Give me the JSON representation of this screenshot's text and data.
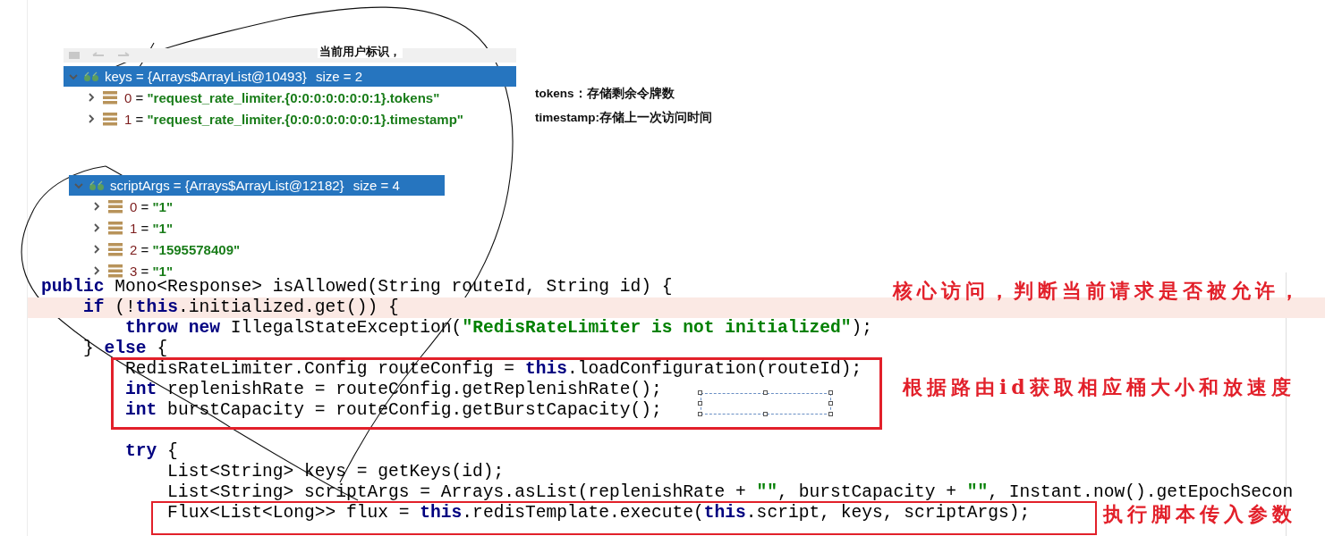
{
  "user_note": "当前用户标识，",
  "panels": [
    {
      "label": "keys = {Arrays$ArrayList@10493}",
      "size": "size = 2",
      "expanded": true,
      "selected": true,
      "items": [
        {
          "index": "0",
          "equals": "=",
          "value": "\"request_rate_limiter.{0:0:0:0:0:0:0:1}.tokens\"",
          "expanded": false
        },
        {
          "index": "1",
          "equals": "=",
          "value": "\"request_rate_limiter.{0:0:0:0:0:0:0:1}.timestamp\"",
          "expanded": false
        }
      ]
    },
    {
      "label": "scriptArgs = {Arrays$ArrayList@12182}",
      "size": "size = 4",
      "expanded": true,
      "selected": true,
      "items": [
        {
          "index": "0",
          "equals": "=",
          "value": "\"1\"",
          "expanded": false
        },
        {
          "index": "1",
          "equals": "=",
          "value": "\"1\"",
          "expanded": false
        },
        {
          "index": "2",
          "equals": "=",
          "value": "\"1595578409\"",
          "expanded": false
        },
        {
          "index": "3",
          "equals": "=",
          "value": "\"1\"",
          "expanded": false
        }
      ]
    }
  ],
  "legend": [
    "tokens：存储剩余令牌数",
    "timestamp:存储上一次访问时间"
  ],
  "code_lines": [
    {
      "kind": "code",
      "highlighted": false,
      "segments": [
        {
          "kind": "keyword",
          "text": "public"
        },
        {
          "kind": "plain",
          "text": " Mono<Response> isAllowed(String routeId, String id) {"
        }
      ]
    },
    {
      "kind": "code",
      "highlighted": true,
      "segments": [
        {
          "kind": "keyword",
          "text": "    if"
        },
        {
          "kind": "plain",
          "text": " (!"
        },
        {
          "kind": "keyword",
          "text": "this"
        },
        {
          "kind": "plain",
          "text": ".initialized.get()) {"
        }
      ]
    },
    {
      "kind": "code",
      "highlighted": false,
      "segments": [
        {
          "kind": "keyword",
          "text": "        throw"
        },
        {
          "kind": "keyword",
          "text": " new"
        },
        {
          "kind": "plain",
          "text": " IllegalStateException("
        },
        {
          "kind": "string",
          "text": "\"RedisRateLimiter is not initialized\""
        },
        {
          "kind": "plain",
          "text": ");"
        }
      ]
    },
    {
      "kind": "code",
      "highlighted": false,
      "segments": [
        {
          "kind": "plain",
          "text": "    } "
        },
        {
          "kind": "keyword",
          "text": "else"
        },
        {
          "kind": "plain",
          "text": " {"
        }
      ]
    },
    {
      "kind": "code",
      "highlighted": false,
      "segments": [
        {
          "kind": "plain",
          "text": "        RedisRateLimiter.Config routeConfig = "
        },
        {
          "kind": "keyword",
          "text": "this"
        },
        {
          "kind": "plain",
          "text": ".loadConfiguration(routeId);"
        }
      ]
    },
    {
      "kind": "code",
      "highlighted": false,
      "segments": [
        {
          "kind": "keyword",
          "text": "        int"
        },
        {
          "kind": "plain",
          "text": " replenishRate = routeConfig.getReplenishRate();"
        }
      ]
    },
    {
      "kind": "code",
      "highlighted": false,
      "segments": [
        {
          "kind": "keyword",
          "text": "        int"
        },
        {
          "kind": "plain",
          "text": " burstCapacity = routeConfig.getBurstCapacity();"
        }
      ]
    },
    {
      "kind": "blank",
      "highlighted": false
    },
    {
      "kind": "code",
      "highlighted": false,
      "segments": [
        {
          "kind": "keyword",
          "text": "        try"
        },
        {
          "kind": "plain",
          "text": " {"
        }
      ]
    },
    {
      "kind": "code",
      "highlighted": false,
      "segments": [
        {
          "kind": "plain",
          "text": "            List<String> keys = getKeys(id);"
        }
      ]
    },
    {
      "kind": "code",
      "highlighted": false,
      "segments": [
        {
          "kind": "plain",
          "text": "            List<String> scriptArgs = Arrays.asList(replenishRate + "
        },
        {
          "kind": "string",
          "text": "\"\""
        },
        {
          "kind": "plain",
          "text": ", burstCapacity + "
        },
        {
          "kind": "string",
          "text": "\"\""
        },
        {
          "kind": "plain",
          "text": ", Instant.now().getEpochSecon"
        }
      ]
    },
    {
      "kind": "code",
      "highlighted": false,
      "segments": [
        {
          "kind": "plain",
          "text": "            Flux<List<Long>> flux = "
        },
        {
          "kind": "keyword",
          "text": "this"
        },
        {
          "kind": "plain",
          "text": ".redisTemplate.execute("
        },
        {
          "kind": "keyword",
          "text": "this"
        },
        {
          "kind": "plain",
          "text": ".script, keys, scriptArgs);"
        }
      ]
    }
  ],
  "annotations": [
    "核心访问，判断当前请求是否被允许，",
    "根据路由id获取相应桶大小和放速度",
    "执行脚本传入参数"
  ]
}
